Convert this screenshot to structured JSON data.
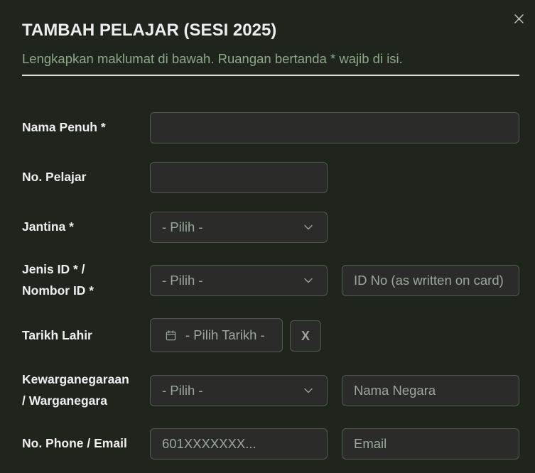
{
  "modal": {
    "title": "TAMBAH PELAJAR (SESI 2025)",
    "subtitle": "Lengkapkan maklumat di bawah. Ruangan bertanda * wajib di isi."
  },
  "form": {
    "full_name": {
      "label": "Nama Penuh *",
      "value": ""
    },
    "student_no": {
      "label": "No. Pelajar",
      "value": ""
    },
    "gender": {
      "label": "Jantina *",
      "selected": "- Pilih -"
    },
    "id": {
      "label_line1": "Jenis ID * /",
      "label_line2": "Nombor ID *",
      "type_selected": "- Pilih -",
      "number_value": "",
      "number_placeholder": "ID No (as written on card)"
    },
    "birth_date": {
      "label": "Tarikh Lahir",
      "placeholder": "- Pilih Tarikh -",
      "clear_button_label": "X"
    },
    "citizenship": {
      "label_line1": "Kewarganegaraan",
      "label_line2": "/ Warganegara",
      "selected": "- Pilih -",
      "country_value": "",
      "country_placeholder": "Nama Negara"
    },
    "contact": {
      "label": "No. Phone / Email",
      "phone_value": "",
      "phone_placeholder": "601XXXXXXX...",
      "email_value": "",
      "email_placeholder": "Email"
    }
  },
  "icons": {
    "close": "close-icon",
    "calendar": "calendar-icon",
    "select_arrow": "chevron-down-icon"
  },
  "colors": {
    "background": "#1f241d",
    "field_bg": "#2b2b2a",
    "field_border": "#4f5b4d",
    "title": "#ededed",
    "subtitle": "#8fa88b",
    "label": "#efefef",
    "placeholder": "#9da79b",
    "divider": "#dedede",
    "icon": "#c4c4c4",
    "field_text": "#dddddd",
    "clear_text": "#a0a0a0"
  }
}
